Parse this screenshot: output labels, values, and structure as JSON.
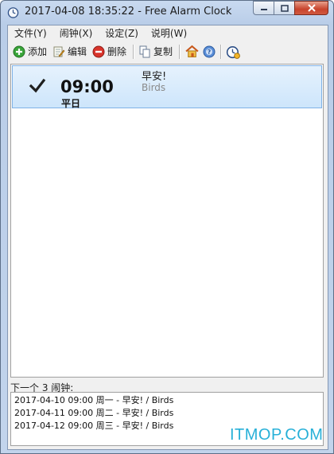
{
  "window": {
    "title": "2017-04-08 18:35:22 - Free Alarm Clock"
  },
  "menu": {
    "items": [
      "文件(Y)",
      "闹钟(X)",
      "设定(Z)",
      "说明(W)"
    ]
  },
  "toolbar": {
    "add_label": "添加",
    "edit_label": "编辑",
    "delete_label": "删除",
    "copy_label": "复制",
    "icons": [
      "add-icon",
      "edit-icon",
      "delete-icon",
      "copy-icon",
      "home-icon",
      "help-icon",
      "clock-settings-icon"
    ]
  },
  "alarms": [
    {
      "enabled": true,
      "time": "09:00",
      "days": "平日",
      "label": "早安!",
      "sound": "Birds"
    }
  ],
  "upcoming": {
    "header": "下一个 3 闹钟:",
    "items": [
      "2017-04-10 09:00 周一 - 早安! / Birds",
      "2017-04-11 09:00 周二 - 早安! / Birds",
      "2017-04-12 09:00 周三 - 早安! / Birds"
    ]
  },
  "watermark": "ITMOP.COM",
  "colors": {
    "selection_bg": "#cde5fb",
    "selection_border": "#7fb2e6",
    "close_button": "#c8432c",
    "add_green": "#3aa53a",
    "delete_red": "#d9342b",
    "watermark": "#27b0d8"
  }
}
